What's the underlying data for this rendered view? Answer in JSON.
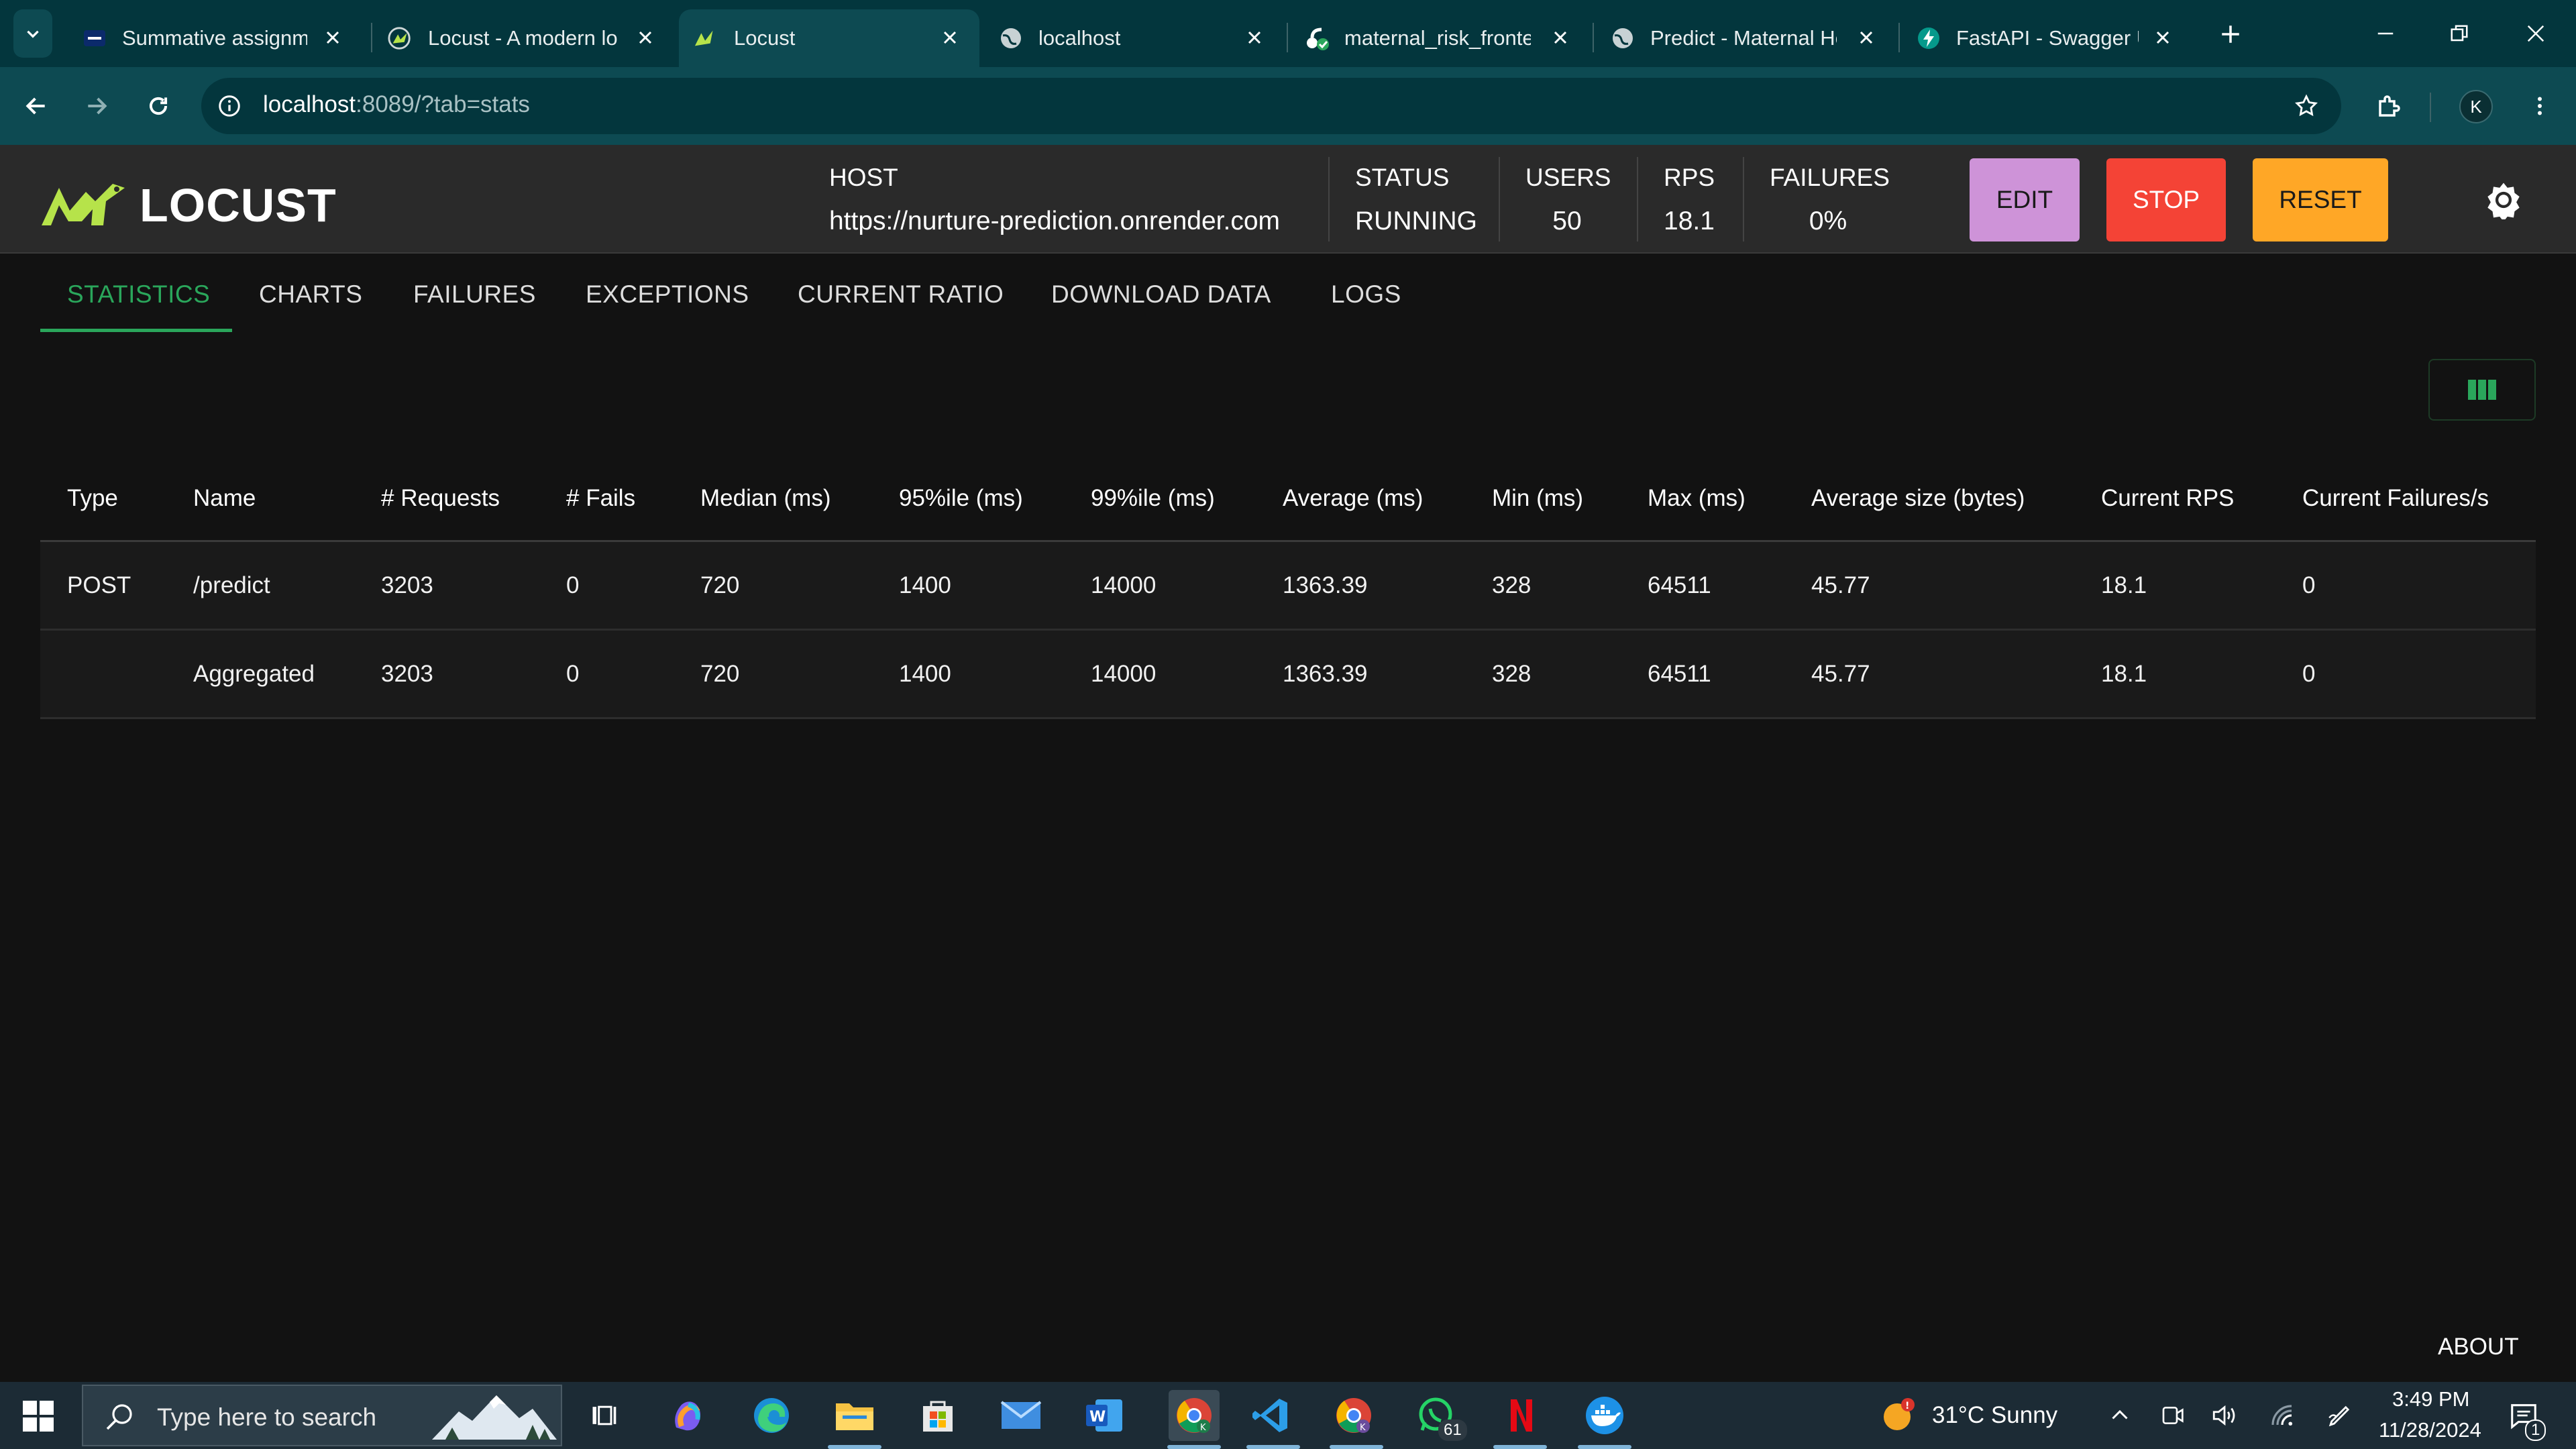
{
  "browser": {
    "tabs": [
      {
        "title": "Summative assignme",
        "favicon": "alu-logo-icon"
      },
      {
        "title": "Locust - A modern lo",
        "favicon": "locust-icon"
      },
      {
        "title": "Locust",
        "favicon": "locust-icon",
        "active": true
      },
      {
        "title": "localhost",
        "favicon": "globe-icon"
      },
      {
        "title": "maternal_risk_fronter",
        "favicon": "render-icon"
      },
      {
        "title": "Predict - Maternal He",
        "favicon": "globe-icon"
      },
      {
        "title": "FastAPI - Swagger UI",
        "favicon": "fastapi-icon"
      }
    ],
    "url_host": "localhost",
    "url_rest": ":8089/?tab=stats",
    "profile_initial": "K"
  },
  "locust": {
    "brand": "LOCUST",
    "host_label": "HOST",
    "host_value": "https://nurture-prediction.onrender.com",
    "status_label": "STATUS",
    "status_value": "RUNNING",
    "users_label": "USERS",
    "users_value": "50",
    "rps_label": "RPS",
    "rps_value": "18.1",
    "failures_label": "FAILURES",
    "failures_value": "0%",
    "edit_label": "EDIT",
    "stop_label": "STOP",
    "reset_label": "RESET",
    "colors": {
      "edit": "#ce93d8",
      "stop": "#f44336",
      "reset": "#ffa726",
      "accent": "#2aa65b"
    }
  },
  "tabs": [
    "STATISTICS",
    "CHARTS",
    "FAILURES",
    "EXCEPTIONS",
    "CURRENT RATIO",
    "DOWNLOAD DATA",
    "LOGS"
  ],
  "table": {
    "headers": [
      "Type",
      "Name",
      "# Requests",
      "# Fails",
      "Median (ms)",
      "95%ile (ms)",
      "99%ile (ms)",
      "Average (ms)",
      "Min (ms)",
      "Max (ms)",
      "Average size (bytes)",
      "Current RPS",
      "Current Failures/s"
    ],
    "rows": [
      [
        "POST",
        "/predict",
        "3203",
        "0",
        "720",
        "1400",
        "14000",
        "1363.39",
        "328",
        "64511",
        "45.77",
        "18.1",
        "0"
      ],
      [
        "",
        "Aggregated",
        "3203",
        "0",
        "720",
        "1400",
        "14000",
        "1363.39",
        "328",
        "64511",
        "45.77",
        "18.1",
        "0"
      ]
    ]
  },
  "about_label": "ABOUT",
  "taskbar": {
    "search_placeholder": "Type here to search",
    "whatsapp_badge": "61",
    "weather": "31°C  Sunny",
    "time": "3:49 PM",
    "date": "11/28/2024",
    "notifications_count": "1"
  }
}
